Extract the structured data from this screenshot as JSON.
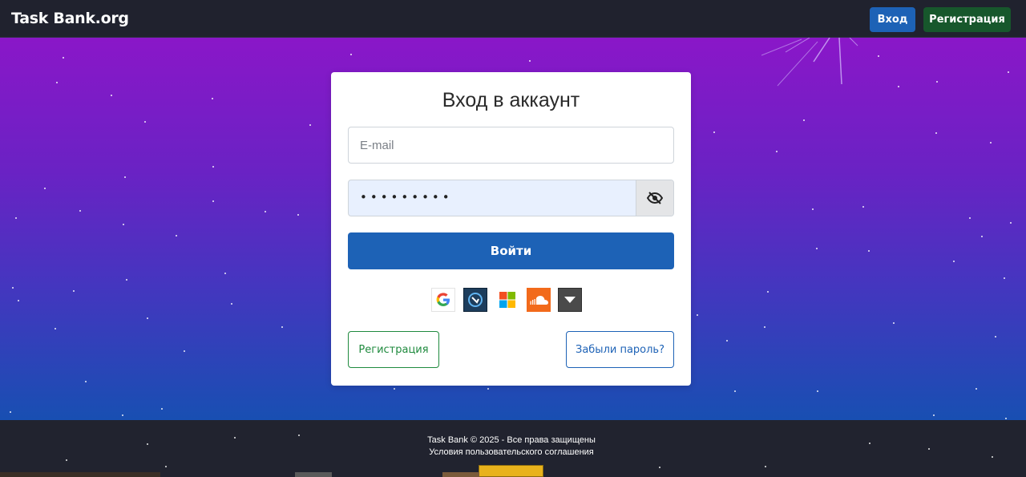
{
  "navbar": {
    "brand": "Task Bank.org",
    "login_label": "Вход",
    "register_label": "Регистрация"
  },
  "login_card": {
    "title": "Вход в аккаунт",
    "email_placeholder": "E-mail",
    "password_value": "•••••••••",
    "submit_label": "Войти",
    "social_providers": [
      "google-icon",
      "generic-oauth-icon",
      "microsoft-icon",
      "soundcloud-icon",
      "more-providers-icon"
    ],
    "register_label": "Регистрация",
    "forgot_label": "Забыли пароль?"
  },
  "footer": {
    "copyright": "Task Bank © 2025 - Все права защищены",
    "terms": "Условия пользовательского соглашения"
  },
  "colors": {
    "primary": "#1d62b6",
    "success": "#17572c",
    "hero_top": "#8a17c8",
    "hero_bottom": "#184fb2",
    "dark": "#20222e"
  }
}
